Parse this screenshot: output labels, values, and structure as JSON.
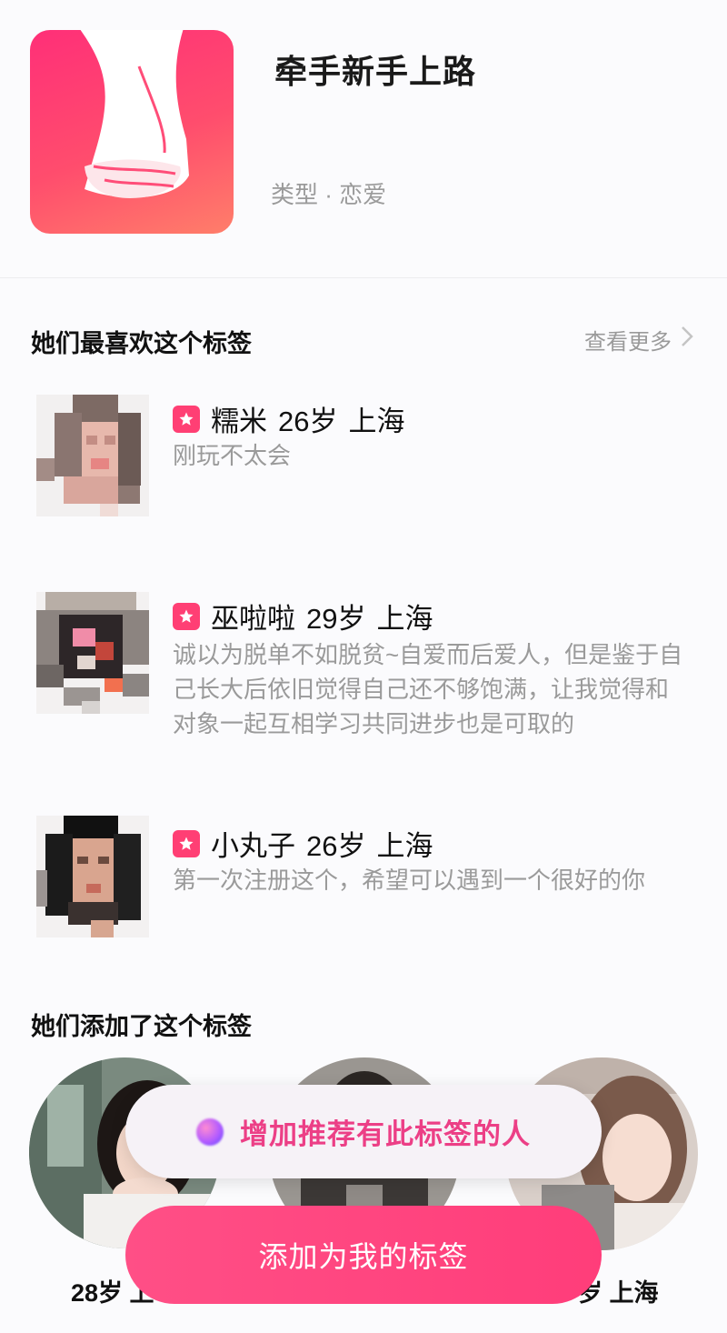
{
  "tag": {
    "title": "牵手新手上路",
    "type_label": "类型 · 恋爱"
  },
  "favorites": {
    "title": "她们最喜欢这个标签",
    "more_label": "查看更多",
    "users": [
      {
        "name": "糯米",
        "age": "26岁",
        "city": "上海",
        "bio": "刚玩不太会"
      },
      {
        "name": "巫啦啦",
        "age": "29岁",
        "city": "上海",
        "bio": "诚以为脱单不如脱贫~自爱而后爱人，但是鉴于自己长大后依旧觉得自己还不够饱满，让我觉得和对象一起互相学习共同进步也是可取的"
      },
      {
        "name": "小丸子",
        "age": "26岁",
        "city": "上海",
        "bio": "第一次注册这个，希望可以遇到一个很好的你"
      }
    ]
  },
  "added": {
    "title": "她们添加了这个标签",
    "people": [
      {
        "label": "28岁 上"
      },
      {
        "label": ""
      },
      {
        "label": "岁 上海"
      }
    ]
  },
  "actions": {
    "recommend_label": "增加推荐有此标签的人",
    "add_label": "添加为我的标签"
  },
  "colors": {
    "accent": "#ff3f74",
    "muted_text": "#9a9a9a"
  }
}
